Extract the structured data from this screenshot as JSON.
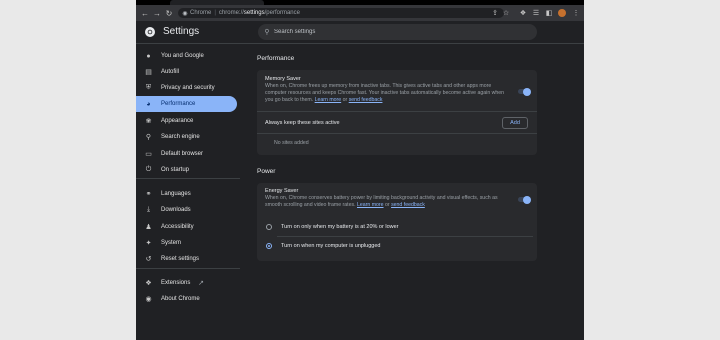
{
  "toolbar": {
    "secure_label": "Chrome",
    "url_prefix": "chrome://",
    "url_host": "settings",
    "url_path": "/performance"
  },
  "header": {
    "title": "Settings",
    "search_placeholder": "Search settings"
  },
  "sidebar": {
    "items": [
      {
        "label": "You and Google",
        "icon": "person-icon"
      },
      {
        "label": "Autofill",
        "icon": "autofill-icon"
      },
      {
        "label": "Privacy and security",
        "icon": "shield-icon"
      },
      {
        "label": "Performance",
        "icon": "speedometer-icon",
        "active": true
      },
      {
        "label": "Appearance",
        "icon": "palette-icon"
      },
      {
        "label": "Search engine",
        "icon": "search-icon"
      },
      {
        "label": "Default browser",
        "icon": "browser-icon"
      },
      {
        "label": "On startup",
        "icon": "power-icon"
      },
      {
        "label": "Languages",
        "icon": "globe-icon"
      },
      {
        "label": "Downloads",
        "icon": "download-icon"
      },
      {
        "label": "Accessibility",
        "icon": "accessibility-icon"
      },
      {
        "label": "System",
        "icon": "wrench-icon"
      },
      {
        "label": "Reset settings",
        "icon": "reset-icon"
      },
      {
        "label": "Extensions",
        "icon": "puzzle-icon"
      },
      {
        "label": "About Chrome",
        "icon": "chrome-icon"
      }
    ]
  },
  "performance": {
    "section_title": "Performance",
    "memory_saver": {
      "title": "Memory Saver",
      "desc": "When on, Chrome frees up memory from inactive tabs. This gives active tabs and other apps more computer resources and keeps Chrome fast. Your inactive tabs automatically become active again when you go back to them.",
      "learn_more": "Learn more",
      "or": "or",
      "send_feedback": "send feedback",
      "enabled": true
    },
    "always_active": {
      "label": "Always keep these sites active",
      "add_label": "Add",
      "empty_text": "No sites added"
    }
  },
  "power": {
    "section_title": "Power",
    "energy_saver": {
      "title": "Energy Saver",
      "desc": "When on, Chrome conserves battery power by limiting background activity and visual effects, such as smooth scrolling and video frame rates.",
      "learn_more": "Learn more",
      "or": "or",
      "send_feedback": "send feedback",
      "enabled": true
    },
    "options": [
      {
        "label": "Turn on only when my battery is at 20% or lower",
        "selected": false
      },
      {
        "label": "Turn on when my computer is unplugged",
        "selected": true
      }
    ]
  },
  "colors": {
    "accent": "#8ab4f8",
    "background": "#202124",
    "card": "#292a2d"
  }
}
